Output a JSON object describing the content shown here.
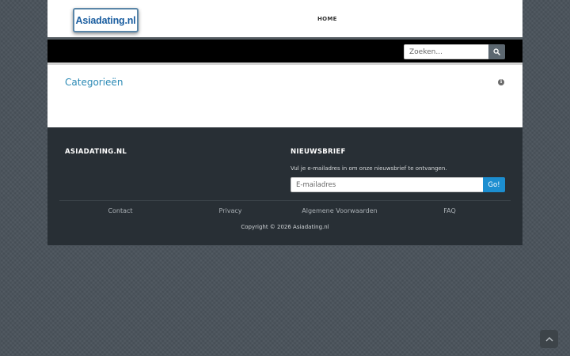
{
  "header": {
    "logo_text": "Asiadating.nl",
    "nav_home": "HOME"
  },
  "search": {
    "placeholder": "Zoeken...",
    "button_icon": "search-icon"
  },
  "main": {
    "title": "Categorieën",
    "info_icon": "info-icon",
    "info_glyph": "i"
  },
  "footer": {
    "brand_title": "ASIADATING.NL",
    "newsletter_title": "NIEUWSBRIEF",
    "newsletter_text": "Vul je e-mailadres in om onze nieuwsbrief te ontvangen.",
    "email_placeholder": "E-mailadres",
    "go_label": "Go!",
    "links": [
      "Contact",
      "Privacy",
      "Algemene Voorwaarden",
      "FAQ"
    ],
    "copyright": "Copyright © 2026 Asiadating.nl"
  },
  "back_to_top_icon": "chevron-up-icon",
  "colors": {
    "accent": "#2a89b5",
    "go_button": "#1c8ed0",
    "footer_bg": "#282f35",
    "search_bar_bg": "#000000"
  }
}
